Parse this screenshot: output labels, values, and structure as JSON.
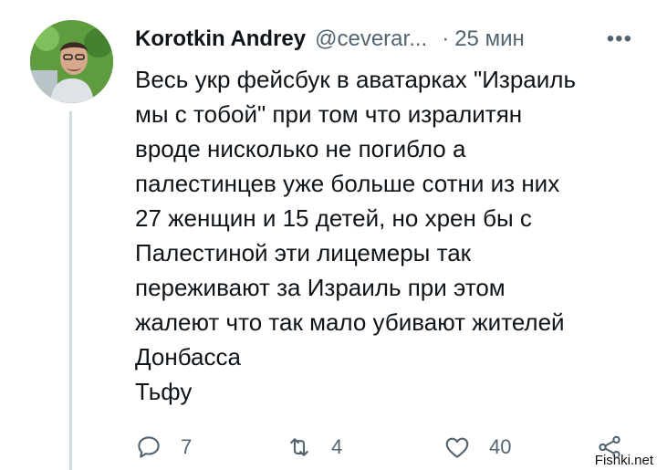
{
  "tweet": {
    "author_name": "Korotkin Andrey",
    "handle": "@ceverar...",
    "separator": "·",
    "time": "25 мин",
    "more_label": "•••",
    "text": "Весь укр фейсбук в аватарках \"Израиль\nмы с тобой\" при том что изралитян\nвроде нисколько не погибло а\nпалестинцев уже больше сотни из них\n27 женщин и 15 детей, но хрен бы с\nПалестиной эти лицемеры так\nпереживают за Израиль при этом\nжалеют что так мало убивают жителей\nДонбасса\nТьфу"
  },
  "actions": {
    "reply_count": "7",
    "retweet_count": "4",
    "like_count": "40"
  },
  "icons": {
    "reply": "reply-icon",
    "retweet": "retweet-icon",
    "like": "heart-icon",
    "share": "share-icon"
  },
  "colors": {
    "text": "#0f1419",
    "secondary": "#536471",
    "thread_line": "#cfd9de"
  },
  "watermark": "Fishki.net"
}
